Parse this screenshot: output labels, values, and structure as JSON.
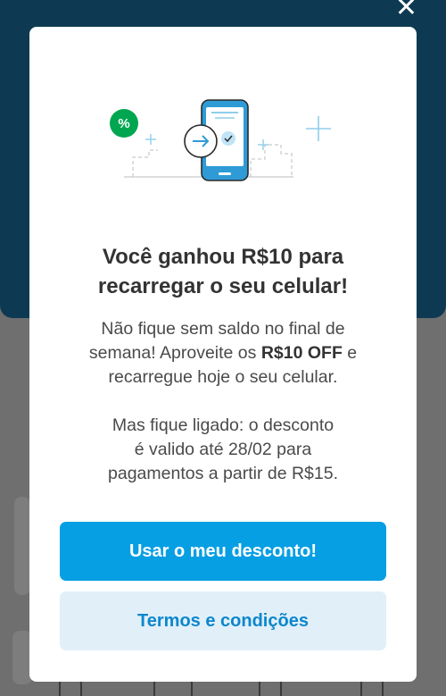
{
  "modal": {
    "title_line1": "Você ganhou R$10 para",
    "title_line2": "recarregar o seu celular!",
    "body_p1_a": "Não fique sem saldo no final de",
    "body_p1_b": "semana! Aproveite os ",
    "body_p1_bold": "R$10 OFF",
    "body_p1_c": " e",
    "body_p1_d": "recarregue hoje o seu celular.",
    "body_p2_a": "Mas fique ligado: o desconto",
    "body_p2_b": "é valido até 28/02 para",
    "body_p2_c": "pagamentos a partir de R$15.",
    "primary_button": "Usar o meu desconto!",
    "secondary_button": "Termos e condições",
    "badge_symbol": "%"
  },
  "colors": {
    "primary": "#079fe3",
    "secondary_bg": "#e1eff9",
    "secondary_text": "#0b87cc",
    "badge": "#00a650",
    "header_bg": "#0d3a52"
  },
  "icons": {
    "close": "close-icon",
    "badge": "discount-badge-icon",
    "phone": "smartphone-illustration",
    "arrow": "arrow-right-icon",
    "check": "check-icon"
  }
}
